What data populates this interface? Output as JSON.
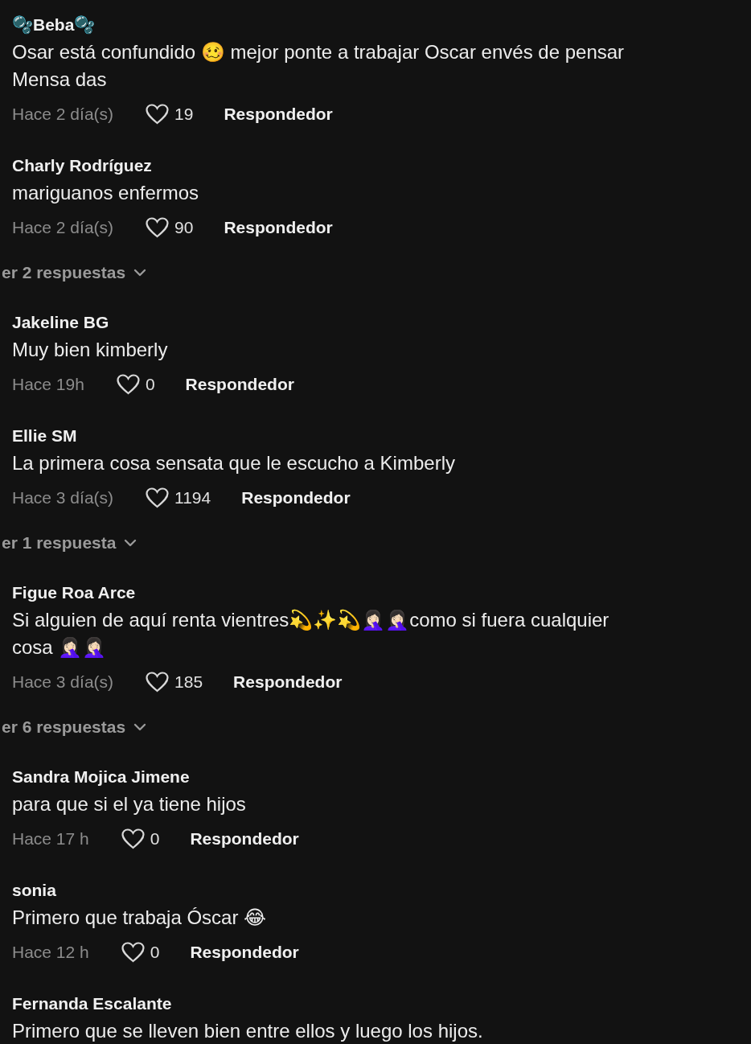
{
  "items": [
    {
      "kind": "comment",
      "name": "🫧Beba🫧",
      "text": "Osar está confundido 🥴 mejor ponte a trabajar Oscar envés de pensar Mensa das",
      "time": "Hace 2 día(s)",
      "likes": "19",
      "reply": "Respondedor"
    },
    {
      "kind": "comment",
      "name": "Charly Rodríguez",
      "text": "mariguanos enfermos",
      "time": "Hace 2 día(s)",
      "likes": "90",
      "reply": "Respondedor"
    },
    {
      "kind": "replies",
      "label": "er 2 respuestas"
    },
    {
      "kind": "comment",
      "name": "Jakeline BG",
      "text": "Muy bien kimberly",
      "time": "Hace 19h",
      "likes": "0",
      "reply": "Respondedor"
    },
    {
      "kind": "comment",
      "name": "Ellie SM",
      "text": "La primera cosa sensata que le escucho a Kimberly",
      "time": "Hace 3 día(s)",
      "likes": "1194",
      "reply": "Respondedor"
    },
    {
      "kind": "replies",
      "label": "er 1 respuesta"
    },
    {
      "kind": "comment",
      "name": "Figue Roa Arce",
      "text": "Si alguien de aquí renta vientres💫✨💫🤦🏻‍♀️🤦🏻‍♀️como si fuera cualquier cosa 🤦🏻‍♀️🤦🏻‍♀️",
      "time": "Hace 3 día(s)",
      "likes": "185",
      "reply": "Respondedor"
    },
    {
      "kind": "replies",
      "label": "er 6 respuestas"
    },
    {
      "kind": "comment",
      "name": "Sandra Mojica Jimene",
      "text": "para que si el ya tiene hijos",
      "time": "Hace 17 h",
      "likes": "0",
      "reply": "Respondedor"
    },
    {
      "kind": "comment",
      "name": "sonia",
      "text": "Primero que trabaja Óscar 😂",
      "time": "Hace 12 h",
      "likes": "0",
      "reply": "Respondedor"
    },
    {
      "kind": "comment",
      "name": "Fernanda Escalante",
      "text": "Primero que se lleven bien entre ellos y luego los hijos."
    }
  ]
}
